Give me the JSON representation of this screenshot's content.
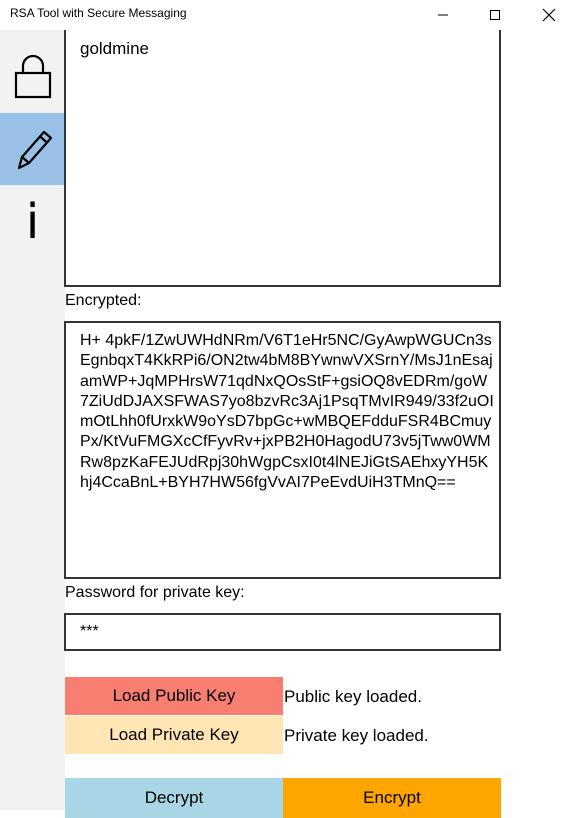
{
  "window": {
    "title": "RSA Tool with Secure Messaging"
  },
  "sidebar": {
    "items": [
      {
        "icon": "lock-icon",
        "selected": false
      },
      {
        "icon": "pencil-icon",
        "selected": true
      },
      {
        "icon": "info-icon",
        "glyph": "i",
        "selected": false
      }
    ]
  },
  "message": {
    "value": "goldmine"
  },
  "encrypted": {
    "label": "Encrypted:",
    "value": "H+ 4pkF/1ZwUWHdNRm/V6T1eHr5NC/GyAwpWGUCn3sEgnbqxT4KkRPi6/ON2tw4bM8BYwnwVXSrnY/MsJ1nEsajamWP+JqMPHrsW71qdNxQOsStF+gsiOQ8vEDRm/goW7ZiUdDJAXSFWAS7yo8bzvRc3Aj1PsqTMvIR949/33f2uOImOtLhh0fUrxkW9oYsD7bpGc+wMBQEFdduFSR4BCmuyPx/KtVuFMGXcCfFyvRv+jxPB2H0HagodU73v5jTww0WMRw8pzKaFEJUdRpj30hWgpCsxI0t4lNEJiGtSAEhxyYH5Khj4CcaBnL+BYH7HW56fgVvAI7PeEvdUiH3TMnQ=="
  },
  "password": {
    "label": "Password for private key:",
    "value": "***"
  },
  "keys": {
    "load_public_label": "Load Public Key",
    "public_status": "Public key loaded.",
    "load_private_label": "Load Private Key",
    "private_status": "Private key loaded."
  },
  "actions": {
    "decrypt_label": "Decrypt",
    "encrypt_label": "Encrypt"
  },
  "colors": {
    "nav_selected": "#99c1e6",
    "load_public": "#f77e71",
    "load_private": "#ffe4b4",
    "decrypt": "#a8d6e6",
    "encrypt": "#ffa500"
  }
}
